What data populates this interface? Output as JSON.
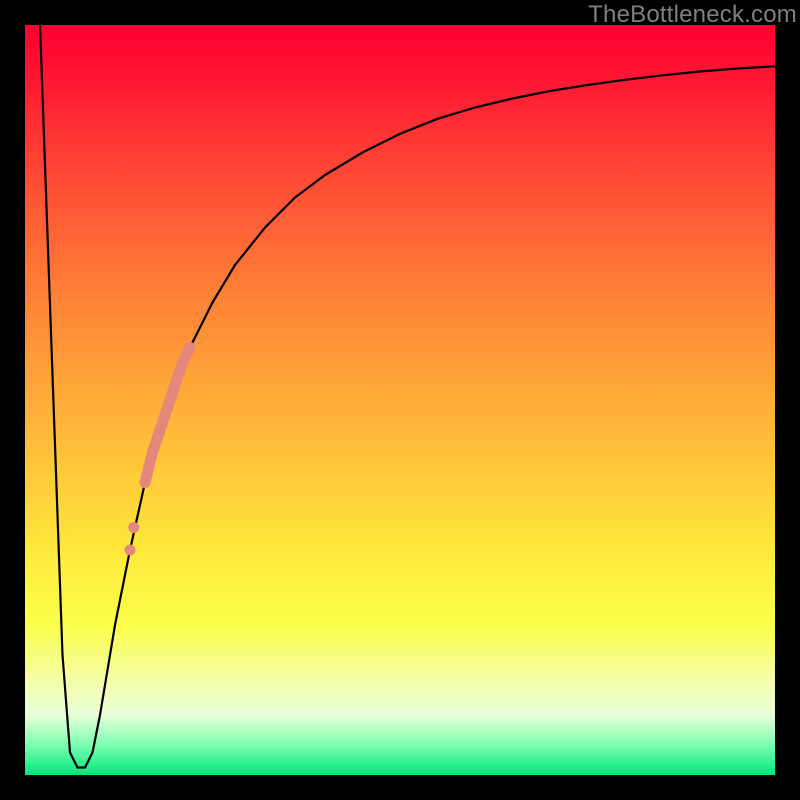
{
  "watermark": "TheBottleneck.com",
  "chart_data": {
    "type": "line",
    "title": "",
    "xlabel": "",
    "ylabel": "",
    "xlim": [
      0,
      100
    ],
    "ylim": [
      0,
      100
    ],
    "grid": false,
    "legend": false,
    "series": [
      {
        "name": "bottleneck-curve",
        "color": "#000000",
        "x": [
          2,
          3,
          4,
          5,
          6,
          7,
          8,
          9,
          10,
          11,
          12,
          14,
          16,
          18,
          20,
          22,
          25,
          28,
          32,
          36,
          40,
          45,
          50,
          55,
          60,
          65,
          70,
          75,
          80,
          85,
          90,
          95,
          100
        ],
        "y": [
          100,
          72,
          44,
          16,
          3,
          1,
          1,
          3,
          8,
          14,
          20,
          30,
          39,
          46,
          52,
          57,
          63,
          68,
          73,
          77,
          80,
          83,
          85.5,
          87.5,
          89,
          90.2,
          91.2,
          92,
          92.7,
          93.3,
          93.8,
          94.2,
          94.5
        ]
      },
      {
        "name": "highlight-segment",
        "color": "#e4887e",
        "x": [
          16,
          17,
          18,
          19,
          20,
          21,
          22
        ],
        "y": [
          39,
          43,
          46,
          49,
          52,
          55,
          57
        ]
      },
      {
        "name": "highlight-dots",
        "color": "#e4887e",
        "x": [
          14.0,
          14.5
        ],
        "y": [
          30,
          33
        ]
      }
    ],
    "gradient_stops": [
      {
        "pos": 0,
        "color": "#ff0030"
      },
      {
        "pos": 22,
        "color": "#ff5035"
      },
      {
        "pos": 46,
        "color": "#ffa038"
      },
      {
        "pos": 70,
        "color": "#ffe83c"
      },
      {
        "pos": 88,
        "color": "#f4ffb0"
      },
      {
        "pos": 100,
        "color": "#00e67a"
      }
    ]
  }
}
